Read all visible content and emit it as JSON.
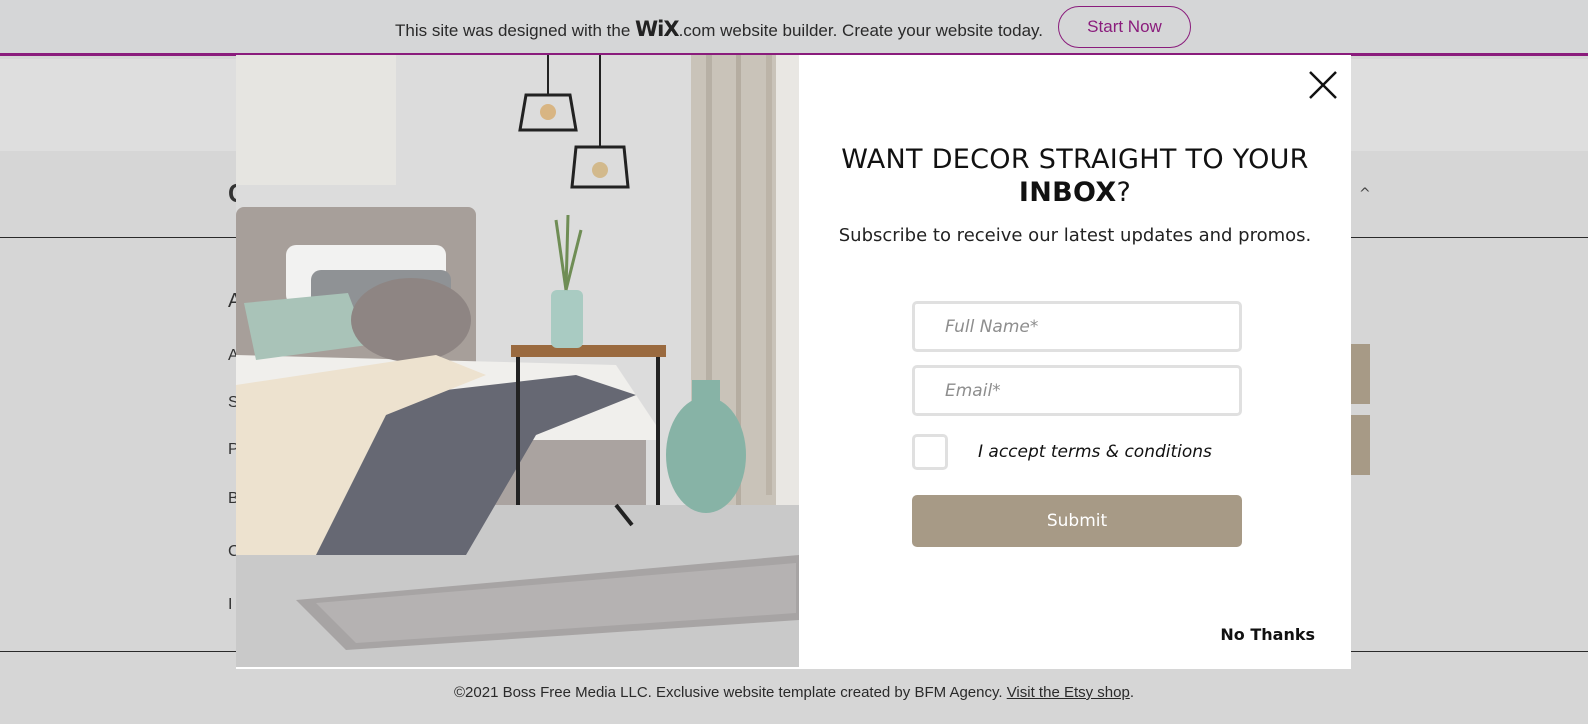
{
  "wix_banner": {
    "text_before": "This site was designed with the ",
    "logo": "WiX",
    "text_after": ".com website builder. Create your website today.",
    "button_label": "Start Now"
  },
  "popup": {
    "headline_line1": "WANT DECOR STRAIGHT TO YOUR",
    "headline_bold": "INBOX",
    "headline_suffix": "?",
    "subtitle": "Subscribe to receive our latest updates and promos.",
    "fields": [
      {
        "placeholder": "Full Name*"
      },
      {
        "placeholder": "Email*"
      }
    ],
    "checkbox_label": "I accept terms & conditions",
    "submit_label": "Submit",
    "no_thanks_label": "No Thanks"
  },
  "footer": {
    "text": "©2021 Boss Free Media LLC. Exclusive website template created by BFM Agency. ",
    "link_label": "Visit the Etsy shop",
    "suffix": "."
  },
  "colors": {
    "accent_wix": "#8a1c7c",
    "submit_bg": "#a79a86",
    "page_bg": "#d6d6d6"
  },
  "icons": {
    "close": "close-icon",
    "nav_caret": "chevron-up-icon"
  }
}
